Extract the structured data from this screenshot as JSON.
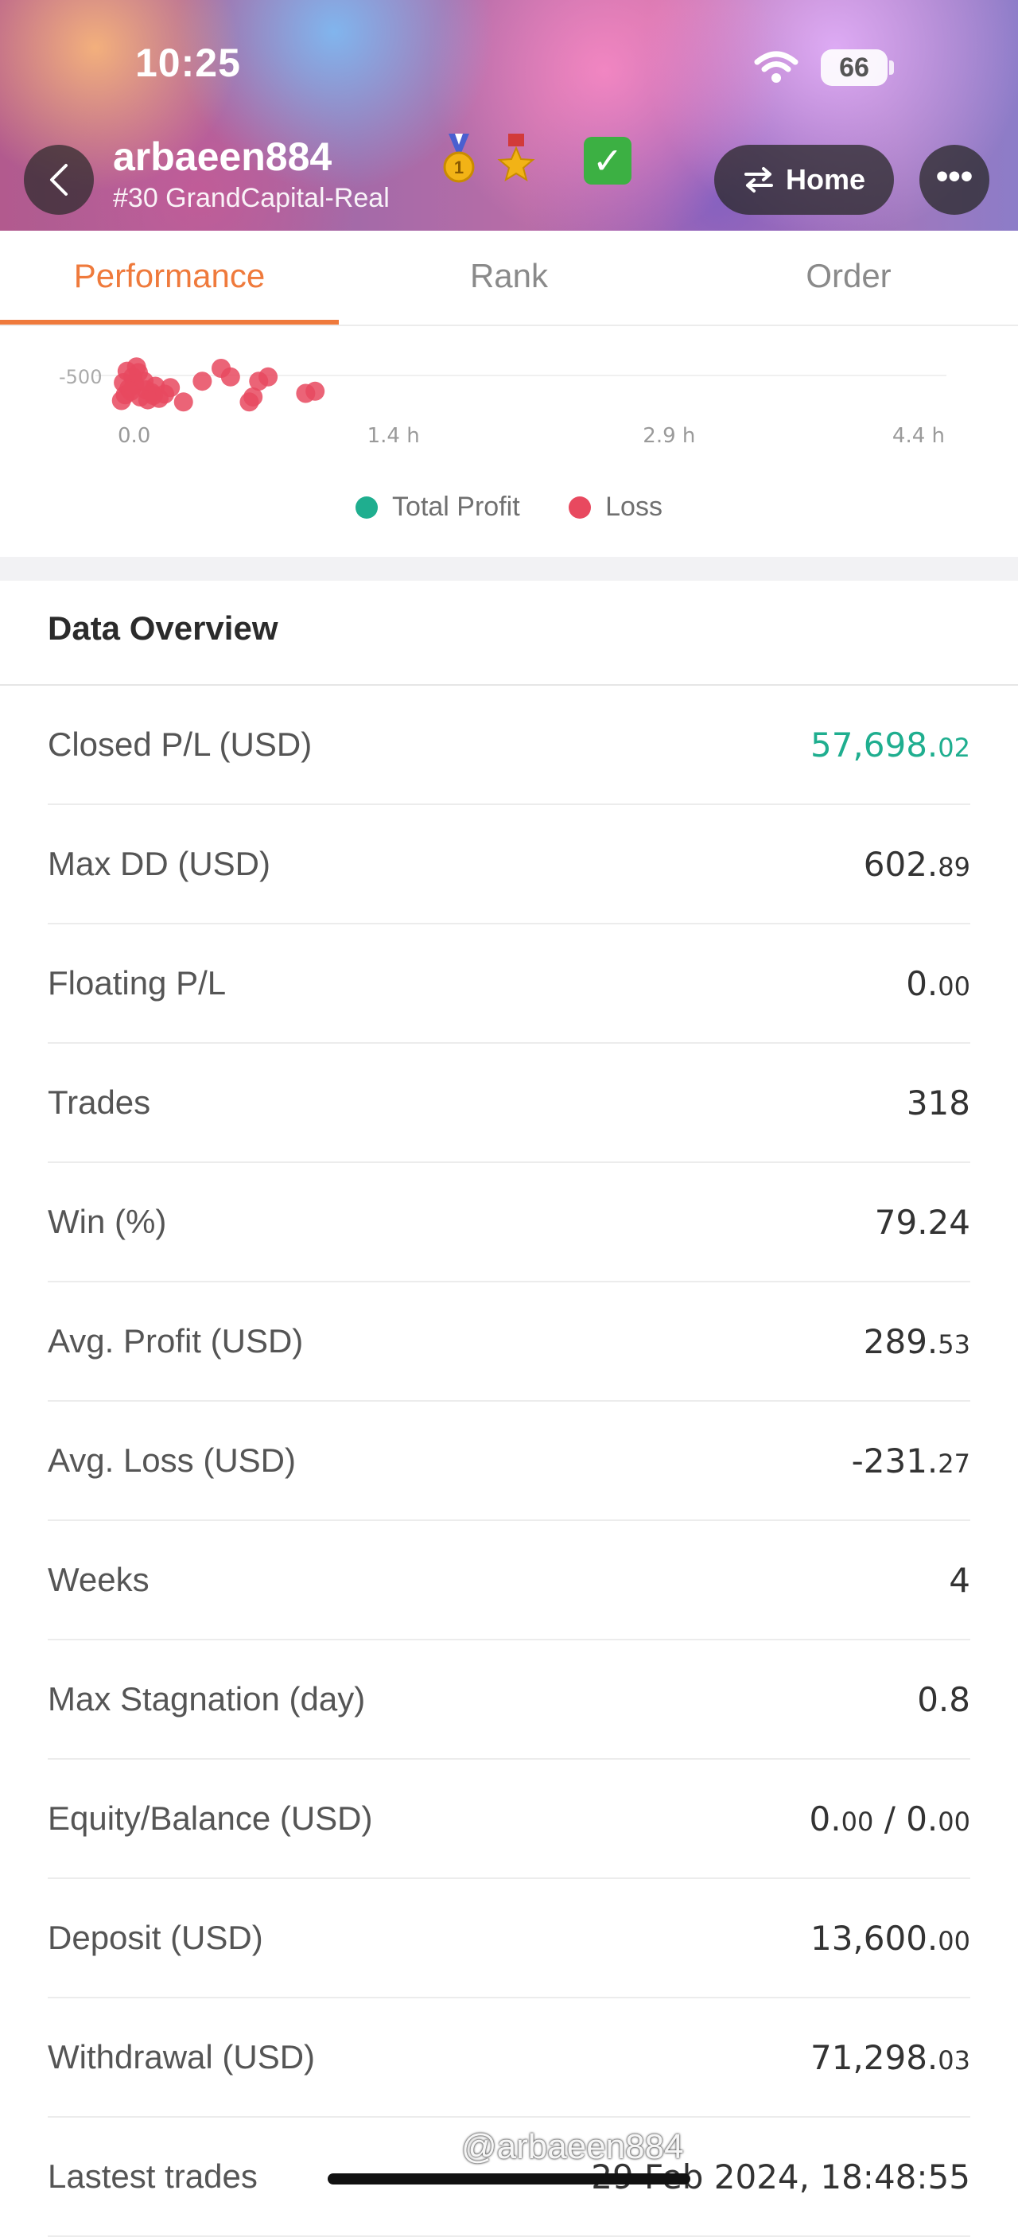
{
  "status_bar": {
    "time": "10:25",
    "battery": "66"
  },
  "header": {
    "username": "arbaeen884",
    "subtitle": "#30 GrandCapital-Real",
    "home_label": "Home",
    "more_label": "•••"
  },
  "tabs": [
    {
      "label": "Performance",
      "active": true
    },
    {
      "label": "Rank",
      "active": false
    },
    {
      "label": "Order",
      "active": false
    }
  ],
  "chart_data": {
    "type": "scatter",
    "y_tick_visible": "-500",
    "x_ticks": [
      "0.0",
      "1.4 h",
      "2.9 h",
      "4.4 h"
    ],
    "xlim": [
      0,
      4.4
    ],
    "series": [
      {
        "name": "Total Profit",
        "color": "#1fae8f",
        "points": []
      },
      {
        "name": "Loss",
        "color": "#e8495f",
        "points": [
          {
            "x": 0.02,
            "y": -150
          },
          {
            "x": 0.04,
            "y": -230
          },
          {
            "x": 0.06,
            "y": -320
          },
          {
            "x": 0.03,
            "y": -400
          },
          {
            "x": 0.08,
            "y": -480
          },
          {
            "x": 0.05,
            "y": -560
          },
          {
            "x": 0.1,
            "y": -620
          },
          {
            "x": 0.12,
            "y": -200
          },
          {
            "x": 0.15,
            "y": -300
          },
          {
            "x": 0.18,
            "y": -260
          },
          {
            "x": 0.2,
            "y": -350
          },
          {
            "x": 0.22,
            "y": -180
          },
          {
            "x": 0.25,
            "y": -240
          },
          {
            "x": 0.28,
            "y": -330
          },
          {
            "x": 0.09,
            "y": -380
          },
          {
            "x": 0.14,
            "y": -420
          },
          {
            "x": 0.07,
            "y": -280
          },
          {
            "x": 0.16,
            "y": -160
          },
          {
            "x": 0.11,
            "y": -540
          },
          {
            "x": 0.19,
            "y": -220
          },
          {
            "x": 0.35,
            "y": -130
          },
          {
            "x": 0.45,
            "y": -420
          },
          {
            "x": 0.55,
            "y": -600
          },
          {
            "x": 0.6,
            "y": -480
          },
          {
            "x": 0.7,
            "y": -130
          },
          {
            "x": 0.72,
            "y": -200
          },
          {
            "x": 0.75,
            "y": -420
          },
          {
            "x": 0.8,
            "y": -480
          },
          {
            "x": 1.0,
            "y": -250
          },
          {
            "x": 1.05,
            "y": -280
          }
        ]
      }
    ],
    "legend": [
      "Total Profit",
      "Loss"
    ]
  },
  "overview": {
    "title": "Data Overview",
    "rows": [
      {
        "label": "Closed P/L (USD)",
        "int": "57,698.",
        "dec": "02",
        "color": "green"
      },
      {
        "label": "Max DD (USD)",
        "int": "602.",
        "dec": "89"
      },
      {
        "label": "Floating P/L",
        "int": "0.",
        "dec": "00"
      },
      {
        "label": "Trades",
        "int": "318",
        "dec": ""
      },
      {
        "label": "Win (%)",
        "int": "79.24",
        "dec": ""
      },
      {
        "label": "Avg. Profit (USD)",
        "int": "289.",
        "dec": "53"
      },
      {
        "label": "Avg. Loss (USD)",
        "int": "-231.",
        "dec": "27"
      },
      {
        "label": "Weeks",
        "int": "4",
        "dec": ""
      },
      {
        "label": "Max Stagnation (day)",
        "int": "0.8",
        "dec": ""
      },
      {
        "label": "Equity/Balance (USD)",
        "int": "0.",
        "dec": "00",
        "int2": " / 0.",
        "dec2": "00"
      },
      {
        "label": "Deposit (USD)",
        "int": "13,600.",
        "dec": "00"
      },
      {
        "label": "Withdrawal (USD)",
        "int": "71,298.",
        "dec": "03"
      },
      {
        "label": "Lastest trades",
        "int": "29 Feb 2024, 18:48:55",
        "dec": ""
      }
    ]
  },
  "watermark": "@arbaeen884"
}
